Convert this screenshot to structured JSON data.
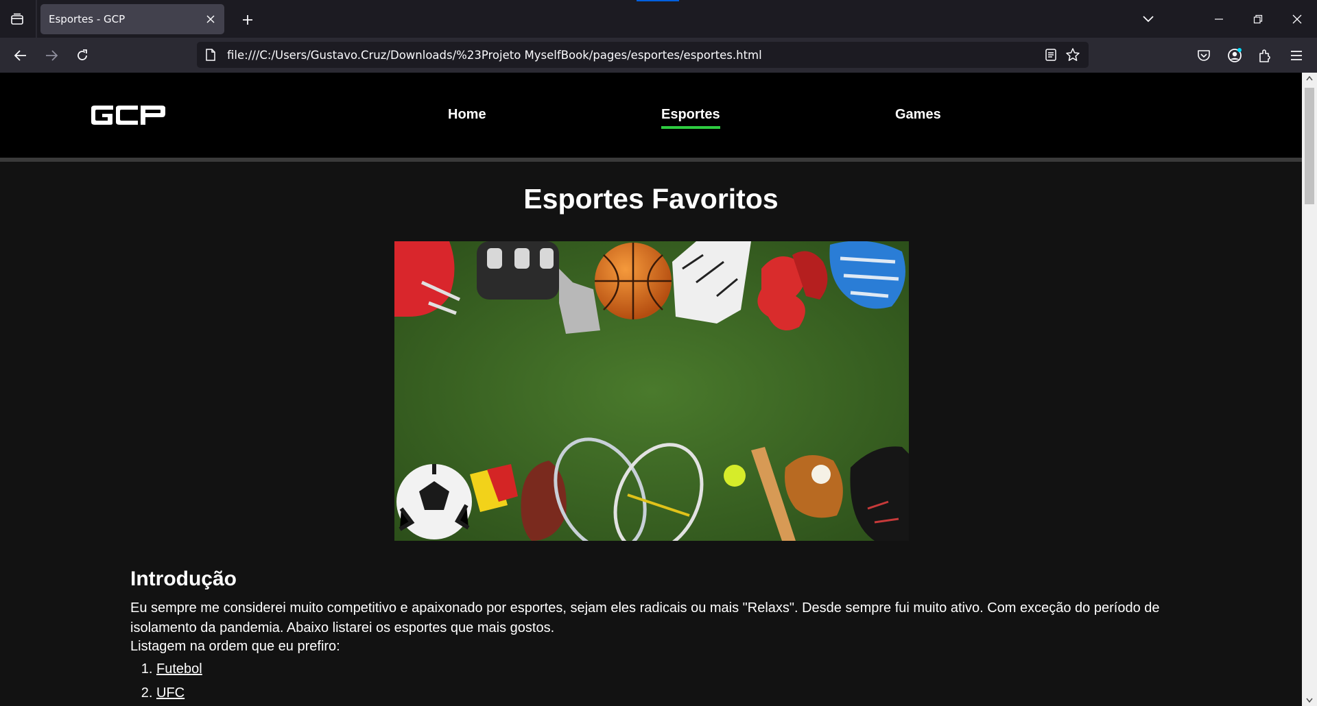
{
  "browser": {
    "tab": {
      "title": "Esportes - GCP"
    },
    "url": "file:///C:/Users/Gustavo.Cruz/Downloads/%23Projeto MyselfBook/pages/esportes/esportes.html",
    "icons": [
      "tab-list-icon",
      "close-icon",
      "plus-icon",
      "chevron-down-icon",
      "minimize-icon",
      "restore-icon",
      "close-window-icon",
      "back-icon",
      "forward-icon",
      "reload-icon",
      "page-icon",
      "reader-view-icon",
      "star-icon",
      "pocket-icon",
      "account-icon",
      "extensions-icon",
      "menu-icon"
    ],
    "colors": {
      "chrome": "#1c1b22",
      "toolbar": "#2b2a33",
      "active_tab": "#42414d"
    }
  },
  "site": {
    "logo_text": "GCP",
    "nav": [
      {
        "label": "Home",
        "active": false
      },
      {
        "label": "Esportes",
        "active": true
      },
      {
        "label": "Games",
        "active": false
      }
    ],
    "colors": {
      "background": "#121212",
      "header": "#000000",
      "active_underline": "#2ecc40"
    }
  },
  "main": {
    "title": "Esportes Favoritos",
    "intro_heading": "Introdução",
    "intro_text": "Eu sempre me considerei muito competitivo e apaixonado por esportes, sejam eles radicais ou mais \"Relaxs\". Desde sempre fui muito ativo. Com exceção do período de isolamento da pandemia. Abaixo listarei os esportes que mais gostos.",
    "list_intro": "Listagem na ordem que eu prefiro:",
    "sports": [
      "Futebol",
      "UFC"
    ]
  }
}
